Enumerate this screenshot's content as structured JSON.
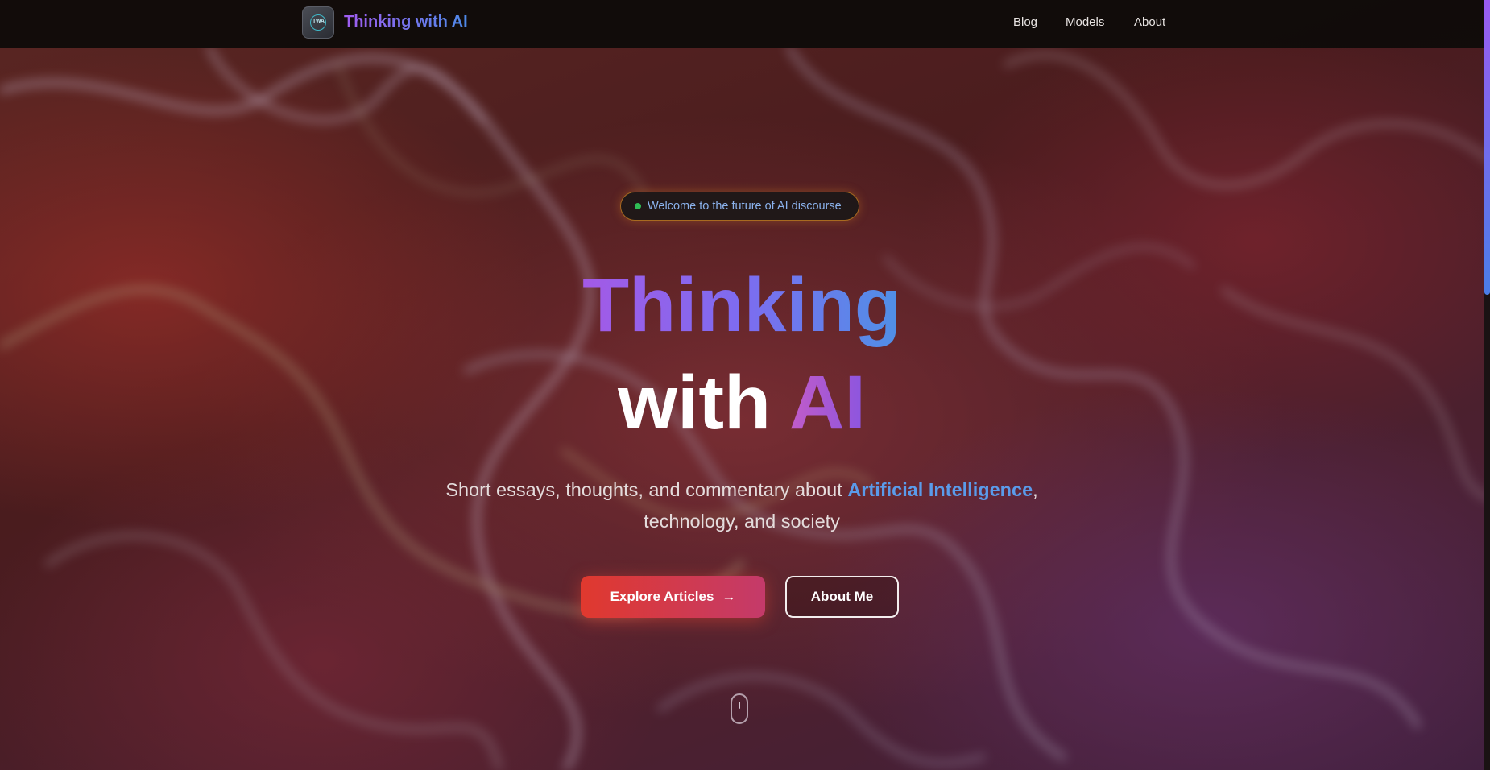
{
  "nav": {
    "logo_text": "TWA",
    "brand": "Thinking with AI",
    "links": [
      {
        "label": "Blog"
      },
      {
        "label": "Models"
      },
      {
        "label": "About"
      }
    ]
  },
  "hero": {
    "badge_text": "Welcome to the future of AI discourse",
    "headline_line1": "Thinking",
    "headline_with": "with",
    "headline_ai": "AI",
    "subtitle_before": "Short essays, thoughts, and commentary about",
    "subtitle_highlight": "Artificial Intelligence",
    "subtitle_comma": ",",
    "subtitle_line2": "technology, and society",
    "primary_button": "Explore Articles",
    "primary_button_arrow": "→",
    "secondary_button": "About Me"
  },
  "colors": {
    "accent_purple": "#a35ae6",
    "accent_blue": "#4f90e6",
    "button_red": "#e0392e",
    "status_green": "#2fbd55"
  },
  "icons": {
    "badge_status": "status-dot-icon",
    "scroll_hint": "mouse-scroll-icon",
    "primary_button_icon": "arrow-right-icon"
  }
}
